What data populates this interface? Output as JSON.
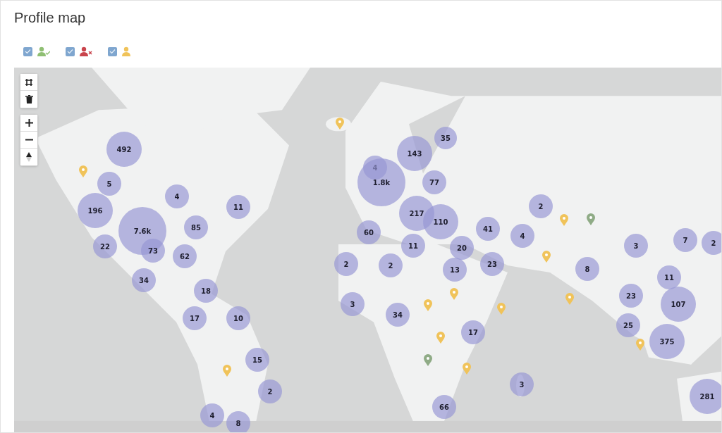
{
  "title": "Profile map",
  "legend": [
    {
      "kind": "check",
      "color": "#8fbf73",
      "checked": true
    },
    {
      "kind": "cross",
      "color": "#c9444c",
      "checked": true
    },
    {
      "kind": "plain",
      "color": "#f0c35a",
      "checked": true
    }
  ],
  "clusters": [
    {
      "count": "492"
    },
    {
      "count": "5"
    },
    {
      "count": "196"
    },
    {
      "count": "7.6k"
    },
    {
      "count": "22"
    },
    {
      "count": "73"
    },
    {
      "count": "4"
    },
    {
      "count": "11"
    },
    {
      "count": "85"
    },
    {
      "count": "62"
    },
    {
      "count": "34"
    },
    {
      "count": "18"
    },
    {
      "count": "17"
    },
    {
      "count": "10"
    },
    {
      "count": "15"
    },
    {
      "count": "2"
    },
    {
      "count": "4"
    },
    {
      "count": "8"
    },
    {
      "count": "35"
    },
    {
      "count": "143"
    },
    {
      "count": "4"
    },
    {
      "count": "1.8k"
    },
    {
      "count": "77"
    },
    {
      "count": "217"
    },
    {
      "count": "110"
    },
    {
      "count": "60"
    },
    {
      "count": "11"
    },
    {
      "count": "41"
    },
    {
      "count": "20"
    },
    {
      "count": "2"
    },
    {
      "count": "4"
    },
    {
      "count": "3"
    },
    {
      "count": "7"
    },
    {
      "count": "2"
    },
    {
      "count": "2"
    },
    {
      "count": "2"
    },
    {
      "count": "13"
    },
    {
      "count": "23"
    },
    {
      "count": "8"
    },
    {
      "count": "11"
    },
    {
      "count": "3"
    },
    {
      "count": "34"
    },
    {
      "count": "17"
    },
    {
      "count": "23"
    },
    {
      "count": "107"
    },
    {
      "count": "25"
    },
    {
      "count": "375"
    },
    {
      "count": "3"
    },
    {
      "count": "66"
    },
    {
      "count": "281"
    }
  ],
  "pins": [
    {
      "color": "#f0c35a"
    },
    {
      "color": "#f0c35a"
    },
    {
      "color": "#f0c35a"
    },
    {
      "color": "#f0c35a"
    },
    {
      "color": "#f0c35a"
    },
    {
      "color": "#f0c35a"
    },
    {
      "color": "#f0c35a"
    },
    {
      "color": "#f0c35a"
    },
    {
      "color": "#f0c35a"
    },
    {
      "color": "#f0c35a"
    },
    {
      "color": "#f0c35a"
    },
    {
      "color": "#f0c35a"
    },
    {
      "color": "#8fab86"
    },
    {
      "color": "#8fab86"
    }
  ]
}
